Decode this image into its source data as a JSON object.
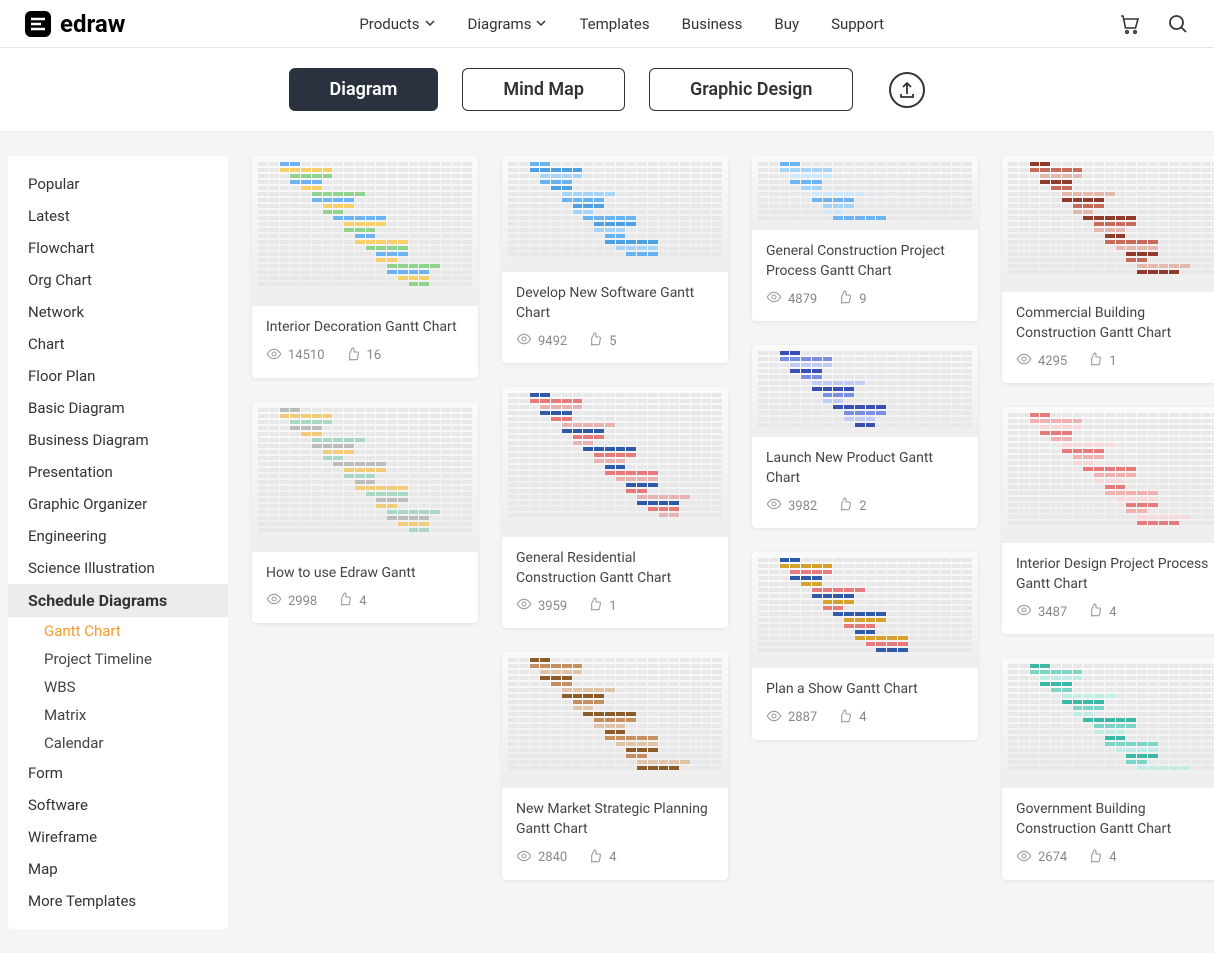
{
  "brand": "edraw",
  "nav": [
    "Products",
    "Diagrams",
    "Templates",
    "Business",
    "Buy",
    "Support"
  ],
  "navHasDropdown": [
    true,
    true,
    false,
    false,
    false,
    false
  ],
  "tabs": [
    "Diagram",
    "Mind Map",
    "Graphic Design"
  ],
  "activeTab": 0,
  "sidebar": {
    "items": [
      "Popular",
      "Latest",
      "Flowchart",
      "Org Chart",
      "Network",
      "Chart",
      "Floor Plan",
      "Basic Diagram",
      "Business Diagram",
      "Presentation",
      "Graphic Organizer",
      "Engineering",
      "Science Illustration",
      "Schedule Diagrams",
      "Form",
      "Software",
      "Wireframe",
      "Map",
      "More Templates"
    ],
    "activeIndex": 13,
    "subItems": [
      "Gantt Chart",
      "Project Timeline",
      "WBS",
      "Matrix",
      "Calendar"
    ],
    "activeSubIndex": 0
  },
  "columns": [
    [
      {
        "title": "Interior Decoration Gantt Chart",
        "views": "14510",
        "likes": "16",
        "thumbH": 150,
        "palette": [
          "#6fb4f2",
          "#f7d06b",
          "#8fd38d"
        ]
      },
      {
        "title": "How to use Edraw Gantt",
        "views": "2998",
        "likes": "4",
        "thumbH": 150,
        "palette": [
          "#bcbcbc",
          "#f3cc7a",
          "#a8d8c4"
        ]
      }
    ],
    [
      {
        "title": "Develop New Software Gantt Chart",
        "views": "9492",
        "likes": "5",
        "thumbH": 116,
        "palette": [
          "#67b2ef",
          "#4f9fe3",
          "#a6d4f7"
        ]
      },
      {
        "title": "General Residential Construction Gantt Chart",
        "views": "3959",
        "likes": "1",
        "thumbH": 150,
        "palette": [
          "#2e5aa8",
          "#e77a7a",
          "#e6b2b2"
        ]
      },
      {
        "title": "New Market Strategic Planning Gantt Chart",
        "views": "2840",
        "likes": "4",
        "thumbH": 136,
        "palette": [
          "#8c5b2a",
          "#c49060",
          "#e0c4a7"
        ]
      }
    ],
    [
      {
        "title": "General Construction Project Process Gantt Chart",
        "views": "4879",
        "likes": "9",
        "thumbH": 74,
        "palette": [
          "#6fb4f2",
          "#a6d4f7",
          "#cfe8fb"
        ]
      },
      {
        "title": "Launch New Product Gantt Chart",
        "views": "3982",
        "likes": "2",
        "thumbH": 92,
        "palette": [
          "#3a4fb3",
          "#7b8fe0",
          "#c2cbf1"
        ]
      },
      {
        "title": "Plan a Show Gantt Chart",
        "views": "2887",
        "likes": "4",
        "thumbH": 116,
        "palette": [
          "#2e5aa8",
          "#d6a22e",
          "#e77a7a"
        ]
      }
    ],
    [
      {
        "title": "Commercial Building Construction Gantt Chart",
        "views": "4295",
        "likes": "1",
        "thumbH": 136,
        "palette": [
          "#8f3b2d",
          "#c76b5a",
          "#e3b8af"
        ]
      },
      {
        "title": "Interior Design Project Process Gantt Chart",
        "views": "3487",
        "likes": "4",
        "thumbH": 136,
        "palette": [
          "#e77a7a",
          "#f0b1b1",
          "#f7d9d9"
        ]
      },
      {
        "title": "Government Building Construction Gantt Chart",
        "views": "2674",
        "likes": "4",
        "thumbH": 130,
        "palette": [
          "#3bb8a6",
          "#7fd4c8",
          "#c2ece5"
        ]
      }
    ]
  ]
}
